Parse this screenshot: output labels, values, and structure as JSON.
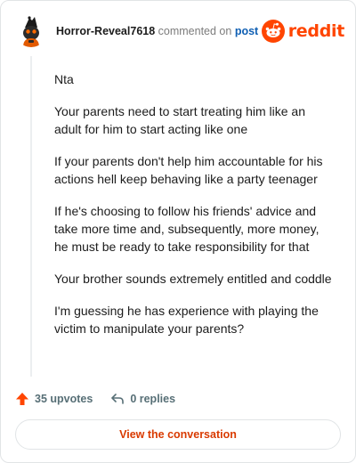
{
  "header": {
    "username": "Horror-Reveal7618",
    "commented_on": "commented on",
    "post_link": "post",
    "brand": "reddit"
  },
  "comment": {
    "paragraphs": [
      "Nta",
      "Your parents need to start treating him like an adult for him to start acting like one",
      "If your parents don't help him accountable for his actions hell keep behaving like a party teenager",
      "If he's choosing to follow his friends' advice and take more time and, subsequently, more money, he must be ready to take responsibility for that",
      "Your brother sounds extremely entitled and coddle",
      "I'm guessing he has experience with playing the victim to manipulate your parents?"
    ]
  },
  "actions": {
    "upvotes": "35 upvotes",
    "replies": "0 replies"
  },
  "cta": {
    "label": "View the conversation"
  },
  "colors": {
    "brand": "#ff4500",
    "link": "#0f5fb3",
    "cta_text": "#d93a00",
    "muted": "#7c7c7c"
  }
}
